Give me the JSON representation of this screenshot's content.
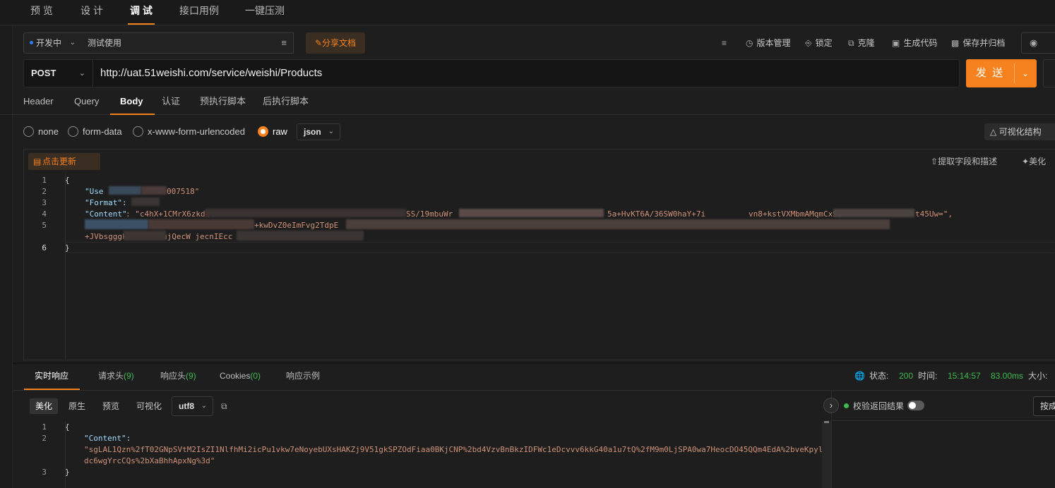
{
  "top_tabs": [
    "预 览",
    "设 计",
    "调 试",
    "接口用例",
    "一键压测"
  ],
  "toolbar": {
    "status": "开发中",
    "api_name": "测试使用",
    "share_label": "分享文档",
    "tools": [
      "版本管理",
      "锁定",
      "克隆",
      "生成代码",
      "保存并归档"
    ]
  },
  "request": {
    "method": "POST",
    "url": "http://uat.51weishi.com/service/weishi/Products",
    "send_label": "发 送"
  },
  "param_tabs": [
    "Header",
    "Query",
    "Body",
    "认证",
    "预执行脚本",
    "后执行脚本"
  ],
  "body_types": [
    "none",
    "form-data",
    "x-www-form-urlencoded",
    "raw"
  ],
  "body_format": "json",
  "visualize_label": "可视化结构",
  "editor": {
    "refresh_label": "点击更新",
    "extract_label": "提取字段和描述",
    "beautify_label": "美化",
    "line_numbers": [
      "1",
      "2",
      "3",
      "4",
      "5",
      "",
      "6"
    ],
    "lines": {
      "open": "{",
      "l2": "\"Use",
      "l2_tail": "007518\"",
      "l3": "\"Format\": \"",
      "l4_key": "\"Content\"",
      "l4_val": ": \"c4hX+1CMrX6zkd8t",
      "l4_mid": "SS/19mbuWr",
      "l4_mid2": "5a+HvKT6A/36SW0haY+7i",
      "l4_mid3": "vn8+kstVXMbmAMqmCxSU",
      "l4_end": "t45Uw=\",",
      "l5_mid": "+kwDvZ0eImFvg2TdpE",
      "l5b": "+JVbsgggk",
      "l5b_tail": "ujQecW jecnIEcc",
      "close": "}"
    }
  },
  "response": {
    "tabs": [
      {
        "label": "实时响应",
        "count": ""
      },
      {
        "label": "请求头",
        "count": "(9)"
      },
      {
        "label": "响应头",
        "count": "(9)"
      },
      {
        "label": "Cookies",
        "count": "(0)"
      },
      {
        "label": "响应示例",
        "count": ""
      }
    ],
    "status_label": "状态:",
    "status_code": "200",
    "time_label": "时间:",
    "time_value": "15:14:57",
    "duration": "83.00ms",
    "size_label": "大小:",
    "view_modes": [
      "美化",
      "原生",
      "预览",
      "可视化"
    ],
    "encoding": "utf8",
    "verify_label": "校验返回结果",
    "right_button": "按成",
    "line_numbers": [
      "1",
      "2",
      "",
      "",
      "3"
    ],
    "body": {
      "open": "{",
      "key": "\"Content\":",
      "value_line1": "\"sgLAL1Qzn%2fT02GNpSVtM2IsZI1NlfhMi2icPu1vkw7eNoyebUXsHAKZj9V51gkSPZOdFiaa0BKjCNP%2bd4VzvBnBkzIDFWc1eDcvvv6kkG40a1u7tQ%2fM9m0LjSPA0wa7HeocDO45QQm4EdA%2bveKpyl",
      "value_line2": "dc6wgYrcCQs%2bXaBhhApxNg%3d\"",
      "close": "}"
    }
  },
  "colors": {
    "accent": "#f5821f",
    "success": "#3fb950",
    "json_key": "#9cdcfe",
    "json_string": "#ce9178"
  }
}
